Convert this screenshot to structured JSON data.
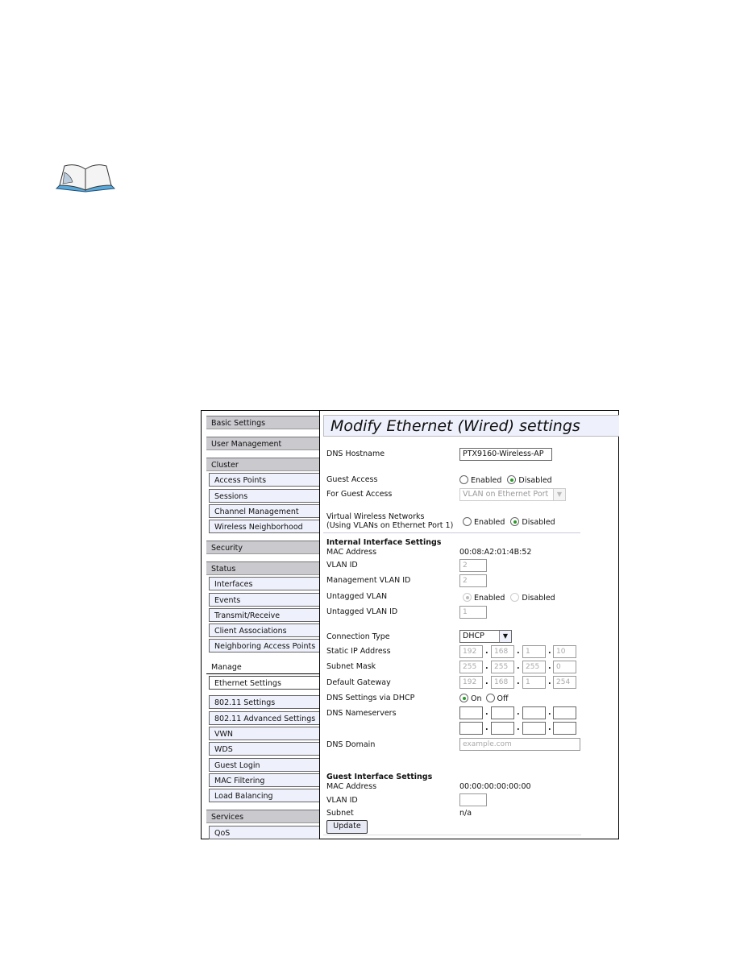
{
  "icons": {
    "note": "open-book-icon"
  },
  "sidebar": {
    "items": [
      {
        "label": "Basic Settings",
        "type": "section"
      },
      {
        "label": "User Management",
        "type": "section"
      },
      {
        "label": "Cluster",
        "type": "section"
      },
      {
        "label": "Access Points",
        "type": "sub"
      },
      {
        "label": "Sessions",
        "type": "sub"
      },
      {
        "label": "Channel Management",
        "type": "sub"
      },
      {
        "label": "Wireless Neighborhood",
        "type": "sub"
      },
      {
        "label": "Security",
        "type": "section"
      },
      {
        "label": "Status",
        "type": "section"
      },
      {
        "label": "Interfaces",
        "type": "sub"
      },
      {
        "label": "Events",
        "type": "sub"
      },
      {
        "label": "Transmit/Receive",
        "type": "sub"
      },
      {
        "label": "Client Associations",
        "type": "sub"
      },
      {
        "label": "Neighboring Access Points",
        "type": "sub"
      },
      {
        "label": "Manage",
        "type": "section-active"
      },
      {
        "label": "Ethernet Settings",
        "type": "sub-selected"
      },
      {
        "label": "802.11 Settings",
        "type": "sub"
      },
      {
        "label": "802.11 Advanced Settings",
        "type": "sub"
      },
      {
        "label": "VWN",
        "type": "sub"
      },
      {
        "label": "WDS",
        "type": "sub"
      },
      {
        "label": "Guest Login",
        "type": "sub"
      },
      {
        "label": "MAC Filtering",
        "type": "sub"
      },
      {
        "label": "Load Balancing",
        "type": "sub"
      },
      {
        "label": "Services",
        "type": "section"
      },
      {
        "label": "QoS",
        "type": "sub"
      }
    ]
  },
  "main": {
    "title": "Modify Ethernet (Wired) settings",
    "dns_hostname": {
      "label": "DNS Hostname",
      "value": "PTX9160-Wireless-AP"
    },
    "guest_access": {
      "label": "Guest Access",
      "enabled": "Enabled",
      "disabled": "Disabled",
      "selected": "Disabled"
    },
    "for_guest_access": {
      "label": "For Guest Access",
      "value": "VLAN on Ethernet Port"
    },
    "vwn": {
      "label1": "Virtual Wireless Networks",
      "label2": "(Using VLANs on Ethernet Port 1)",
      "enabled": "Enabled",
      "disabled": "Disabled",
      "selected": "Disabled"
    },
    "internal": {
      "heading": "Internal Interface Settings",
      "mac_label": "MAC Address",
      "mac_value": "00:08:A2:01:4B:52",
      "vlan_label": "VLAN ID",
      "vlan_value": "2",
      "mgmt_vlan_label": "Management VLAN ID",
      "mgmt_vlan_value": "2",
      "untagged_label": "Untagged VLAN",
      "untagged_enabled": "Enabled",
      "untagged_disabled": "Disabled",
      "untagged_selected": "Enabled",
      "untagged_id_label": "Untagged VLAN ID",
      "untagged_id_value": "1",
      "conn_label": "Connection Type",
      "conn_value": "DHCP",
      "static_ip_label": "Static IP Address",
      "static_ip": [
        "192",
        "168",
        "1",
        "10"
      ],
      "subnet_label": "Subnet Mask",
      "subnet": [
        "255",
        "255",
        "255",
        "0"
      ],
      "gateway_label": "Default Gateway",
      "gateway": [
        "192",
        "168",
        "1",
        "254"
      ],
      "dns_dhcp_label": "DNS Settings via DHCP",
      "dns_on": "On",
      "dns_off": "Off",
      "dns_selected": "On",
      "nameservers_label": "DNS Nameservers",
      "dns_domain_label": "DNS Domain",
      "dns_domain_placeholder": "example.com"
    },
    "guest": {
      "heading": "Guest Interface Settings",
      "mac_label": "MAC Address",
      "mac_value": "00:00:00:00:00:00",
      "vlan_label": "VLAN ID",
      "vlan_value": "",
      "subnet_label": "Subnet",
      "subnet_value": "n/a"
    },
    "update_label": "Update"
  }
}
